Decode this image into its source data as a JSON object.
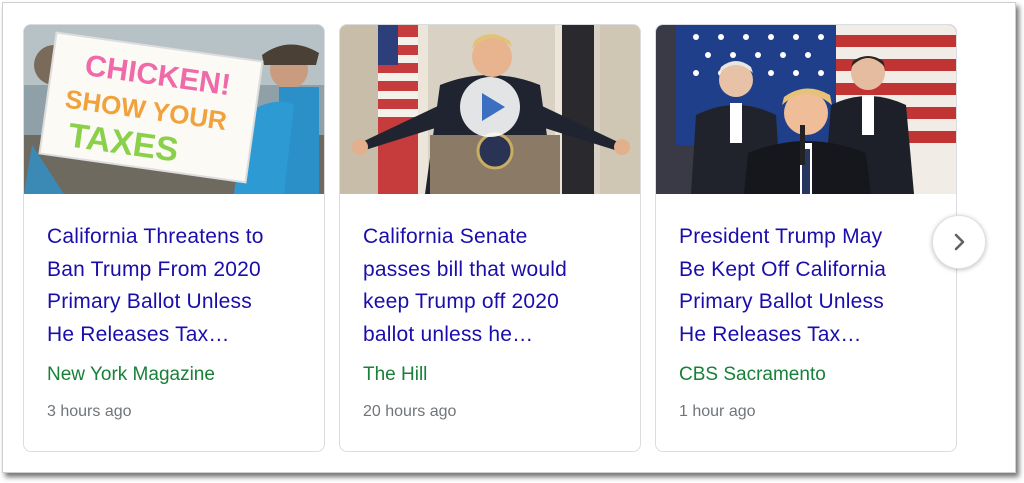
{
  "carousel": {
    "cards": [
      {
        "headline_lines": [
          "California Threatens to",
          "Ban Trump From 2020",
          "Primary Ballot Unless",
          "He Releases Tax…"
        ],
        "source": "New York Magazine",
        "time": "3 hours ago",
        "thumbnail": {
          "icon": "protest-sign-photo",
          "sign_text": [
            "CHICKEN!",
            "SHOW YOUR",
            "TAXES"
          ]
        }
      },
      {
        "headline_lines": [
          "California Senate",
          "passes bill that would",
          "keep Trump off 2020",
          "ballot unless he…"
        ],
        "source": "The Hill",
        "time": "20 hours ago",
        "thumbnail": {
          "icon": "speech-podium-photo",
          "has_video": true
        }
      },
      {
        "headline_lines": [
          "President Trump May",
          "Be Kept Off California",
          "Primary Ballot Unless",
          "He Releases Tax…"
        ],
        "source": "CBS Sacramento",
        "time": "1 hour ago",
        "thumbnail": {
          "icon": "congress-address-photo"
        }
      }
    ],
    "next_button": {
      "icon": "chevron-right-icon"
    }
  },
  "colors": {
    "headline": "#1a0dab",
    "source": "#188038",
    "time": "#70757a",
    "border": "#dadce0"
  }
}
